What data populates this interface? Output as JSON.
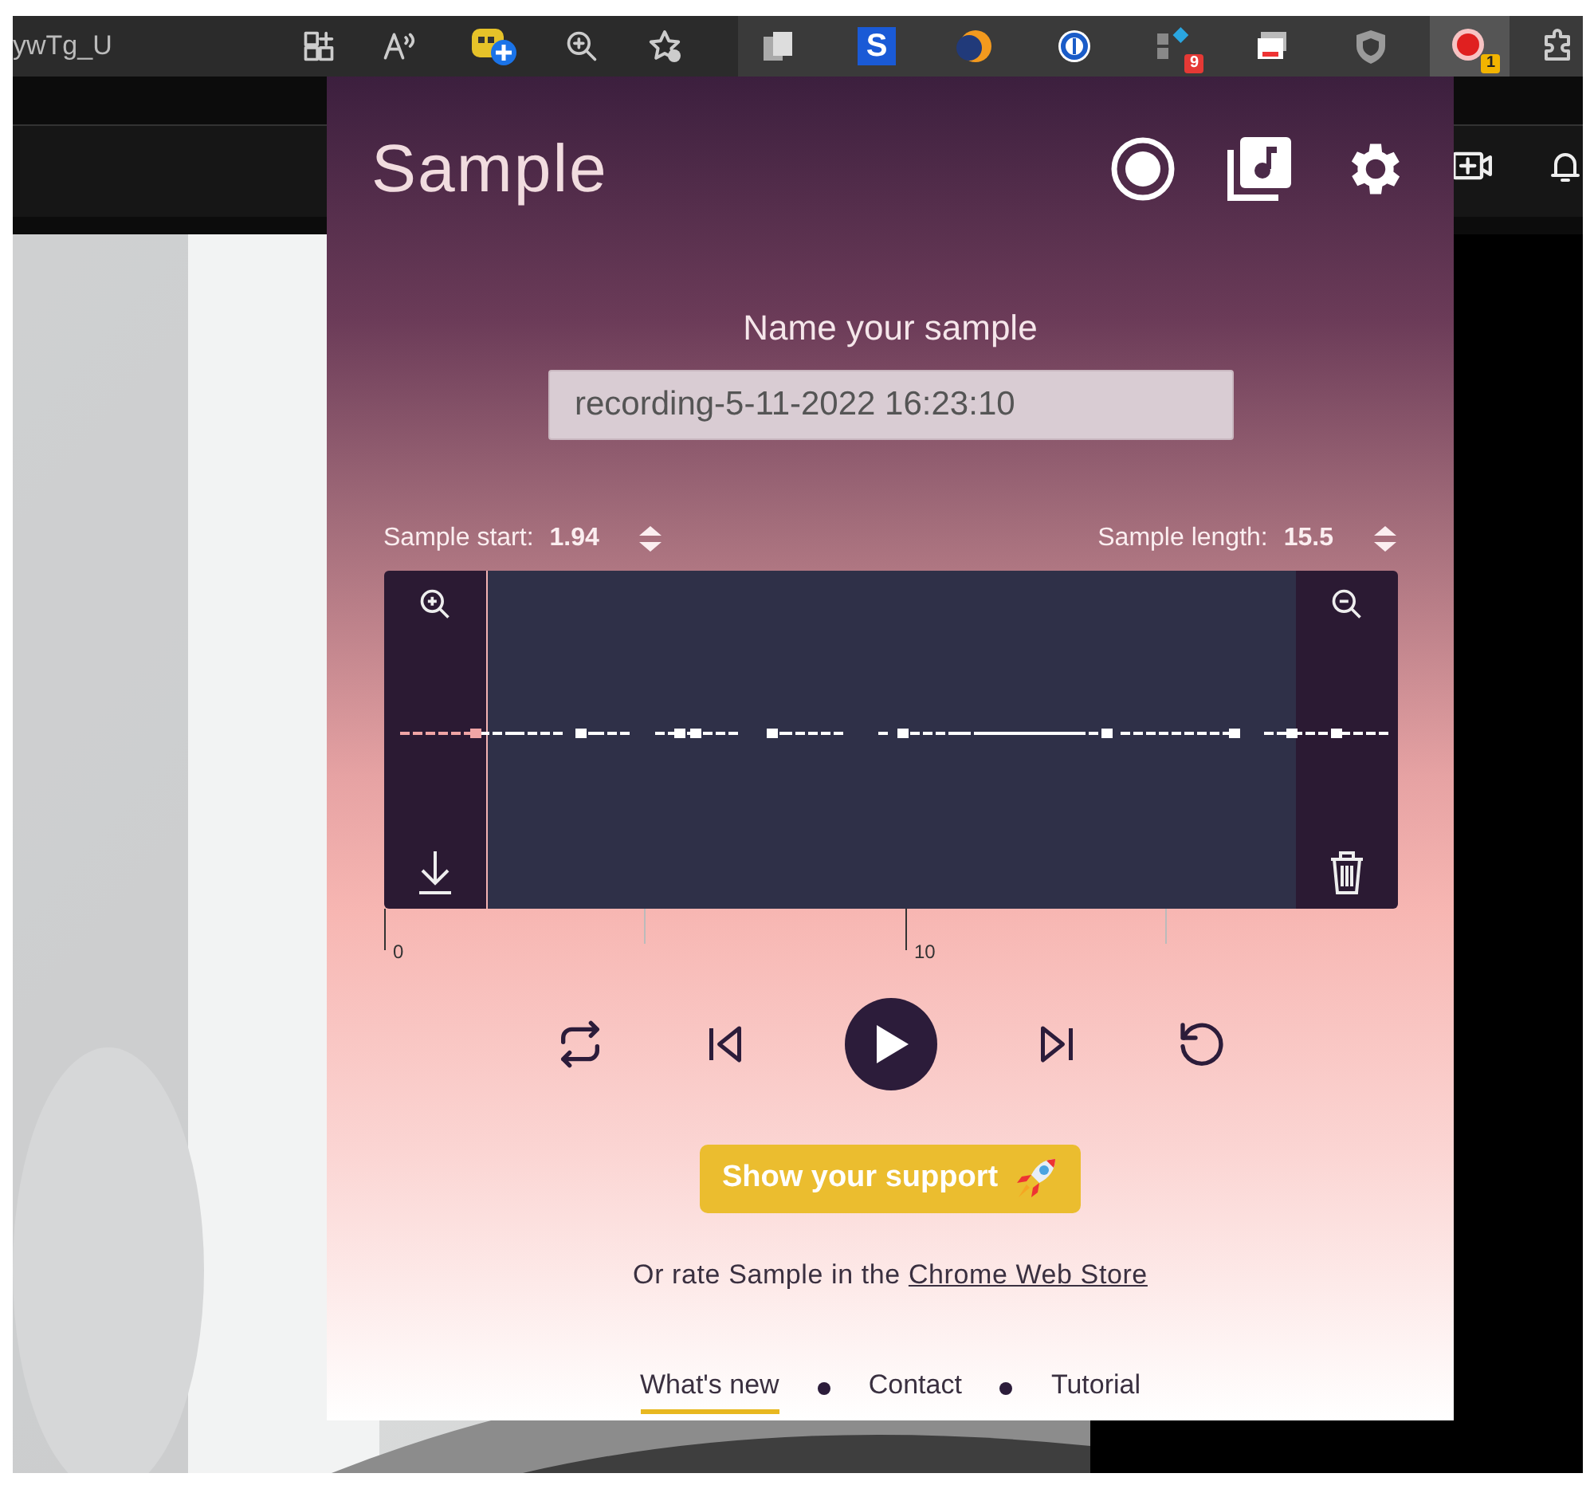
{
  "browser": {
    "address_fragment": "ywTg_U",
    "extensions": [
      {
        "kind": "plain",
        "selected": false
      },
      {
        "kind": "letter",
        "label": "S",
        "selected": false
      },
      {
        "kind": "moon",
        "selected": false
      },
      {
        "kind": "ring",
        "selected": false
      },
      {
        "kind": "blocks",
        "badge": "9",
        "color": "#e53935",
        "selected": false
      },
      {
        "kind": "slides",
        "selected": false
      },
      {
        "kind": "shield",
        "selected": false
      },
      {
        "kind": "record",
        "badge": "1",
        "color": "#f2b400",
        "selected": true
      }
    ]
  },
  "popup": {
    "title": "Sample",
    "name_label": "Name your sample",
    "name_value": "recording-5-11-2022 16:23:10",
    "sample_start": {
      "label": "Sample start:",
      "value": "1.94"
    },
    "sample_length": {
      "label": "Sample length:",
      "value": "15.5"
    },
    "timeline_ticks": [
      "0",
      "10"
    ],
    "support_button": "Show your support",
    "rate_text": "Or rate Sample in the ",
    "rate_link": "Chrome Web Store",
    "footer_links": [
      {
        "label": "What's new",
        "selected": true
      },
      {
        "label": "Contact",
        "selected": false
      },
      {
        "label": "Tutorial",
        "selected": false
      }
    ]
  }
}
